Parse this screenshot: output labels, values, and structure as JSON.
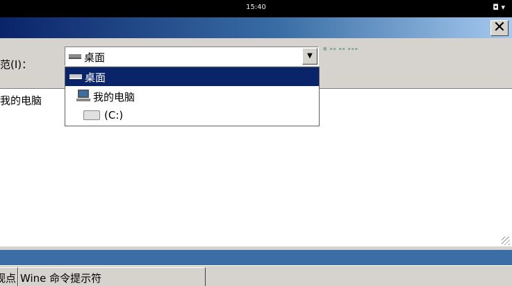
{
  "status_bar": {
    "time": "15:40",
    "icons": "◘ ▾"
  },
  "window": {
    "close_label": "✕",
    "look_in_label": "范(I)：",
    "combo": {
      "value": "桌面"
    },
    "toolbar_hint": "■ ▪▪ ▪▪ ▪▪▪",
    "file_list": {
      "items": [
        {
          "label": "我的电脑"
        }
      ]
    },
    "dropdown": {
      "items": [
        {
          "label": "桌面",
          "icon": "drive-icon",
          "selected": true
        },
        {
          "label": "我的电脑",
          "icon": "computer-icon",
          "selected": false
        },
        {
          "label": "(C:)",
          "icon": "disk-icon",
          "selected": false
        }
      ]
    }
  },
  "taskbar": {
    "buttons": [
      {
        "label": "视点"
      },
      {
        "label": "Wine 命令提示符"
      }
    ]
  }
}
